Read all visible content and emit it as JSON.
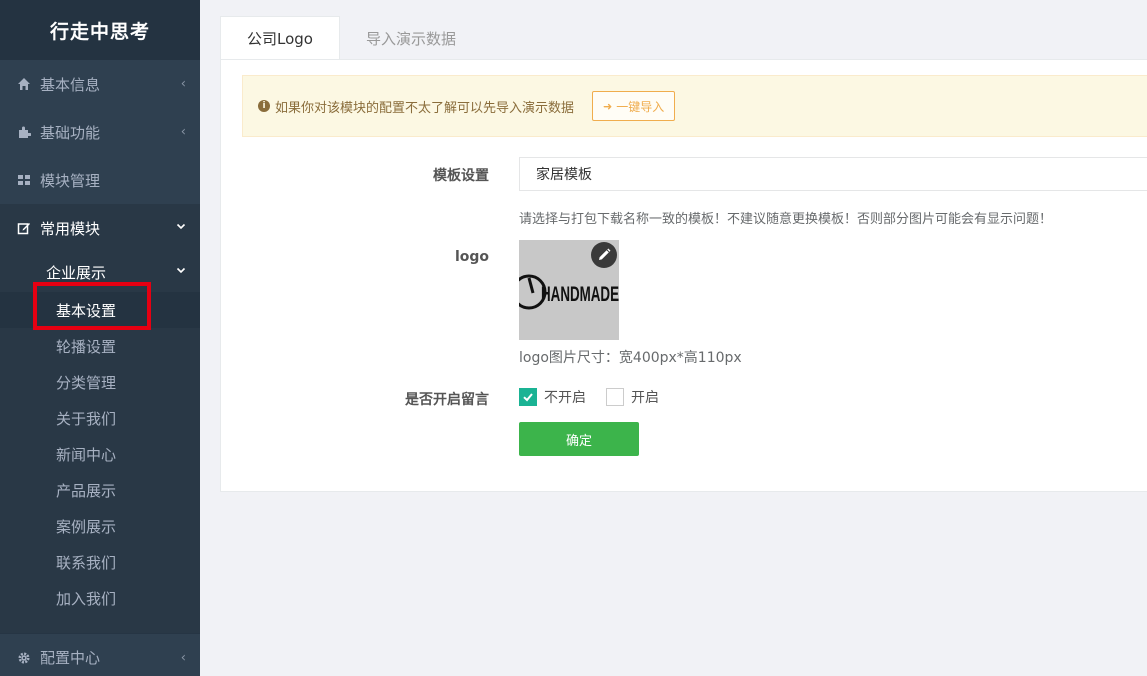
{
  "sidebar": {
    "brand": "行走中思考",
    "items": [
      {
        "label": "基本信息",
        "icon": "home-icon"
      },
      {
        "label": "基础功能",
        "icon": "puzzle-icon"
      },
      {
        "label": "模块管理",
        "icon": "grid-icon"
      },
      {
        "label": "常用模块",
        "icon": "edit-icon"
      }
    ],
    "sub_group": {
      "label": "企业展示",
      "items": [
        "基本设置",
        "轮播设置",
        "分类管理",
        "关于我们",
        "新闻中心",
        "产品展示",
        "案例展示",
        "联系我们",
        "加入我们"
      ]
    },
    "bottom": {
      "label": "配置中心",
      "icon": "gear-icon"
    }
  },
  "tabs": [
    "公司Logo",
    "导入演示数据"
  ],
  "alert": {
    "text": "如果你对该模块的配置不太了解可以先导入演示数据",
    "button": "一键导入"
  },
  "form": {
    "template_label": "模板设置",
    "template_value": "家居模板",
    "template_help": "请选择与打包下载名称一致的模板！不建议随意更换模板！否则部分图片可能会有显示问题！",
    "logo_label": "logo",
    "logo_text": "HANDMADE",
    "logo_size": "logo图片尺寸：宽400px*高110px",
    "comment_label": "是否开启留言",
    "options": [
      {
        "label": "不开启",
        "checked": true
      },
      {
        "label": "开启",
        "checked": false
      }
    ],
    "submit": "确定"
  },
  "colors": {
    "sidebar_bg": "#2f4050",
    "highlight": "#e60012",
    "submit_green": "#3cb44b",
    "checkbox_green": "#1ab394"
  }
}
